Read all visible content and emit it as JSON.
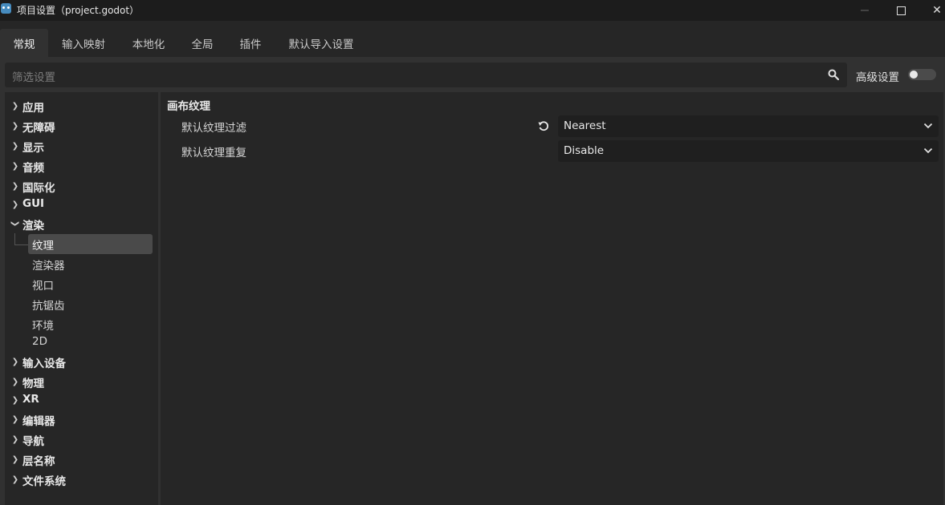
{
  "window": {
    "title": "项目设置（project.godot）",
    "minimize_icon": "minimize-icon",
    "maximize_icon": "maximize-icon",
    "close_symbol": "✕"
  },
  "tabs": [
    {
      "label": "常规",
      "active": true
    },
    {
      "label": "输入映射"
    },
    {
      "label": "本地化"
    },
    {
      "label": "全局"
    },
    {
      "label": "插件"
    },
    {
      "label": "默认导入设置"
    }
  ],
  "search": {
    "placeholder": "筛选设置",
    "icon": "search-icon"
  },
  "advanced": {
    "label": "高级设置",
    "enabled": false
  },
  "tree": {
    "categories": [
      {
        "label": "应用",
        "expanded": false
      },
      {
        "label": "无障碍",
        "expanded": false
      },
      {
        "label": "显示",
        "expanded": false
      },
      {
        "label": "音频",
        "expanded": false
      },
      {
        "label": "国际化",
        "expanded": false
      },
      {
        "label": "GUI",
        "expanded": false
      },
      {
        "label": "渲染",
        "expanded": true
      },
      {
        "label": "输入设备",
        "expanded": false
      },
      {
        "label": "物理",
        "expanded": false
      },
      {
        "label": "XR",
        "expanded": false
      },
      {
        "label": "编辑器",
        "expanded": false
      },
      {
        "label": "导航",
        "expanded": false
      },
      {
        "label": "层名称",
        "expanded": false
      },
      {
        "label": "文件系统",
        "expanded": false
      }
    ],
    "rendering_children": [
      {
        "label": "纹理",
        "selected": true
      },
      {
        "label": "渲染器"
      },
      {
        "label": "视口"
      },
      {
        "label": "抗锯齿"
      },
      {
        "label": "环境"
      },
      {
        "label": "2D"
      }
    ]
  },
  "inspector": {
    "section_title": "画布纹理",
    "properties": [
      {
        "label": "默认纹理过滤",
        "value": "Nearest",
        "revertable": true
      },
      {
        "label": "默认纹理重复",
        "value": "Disable",
        "revertable": false
      }
    ]
  },
  "colors": {
    "background": "#1c1c1c",
    "panel": "#313131",
    "well": "#262626",
    "selection": "#4a4a4a",
    "godot_blue": "#478cbf"
  }
}
